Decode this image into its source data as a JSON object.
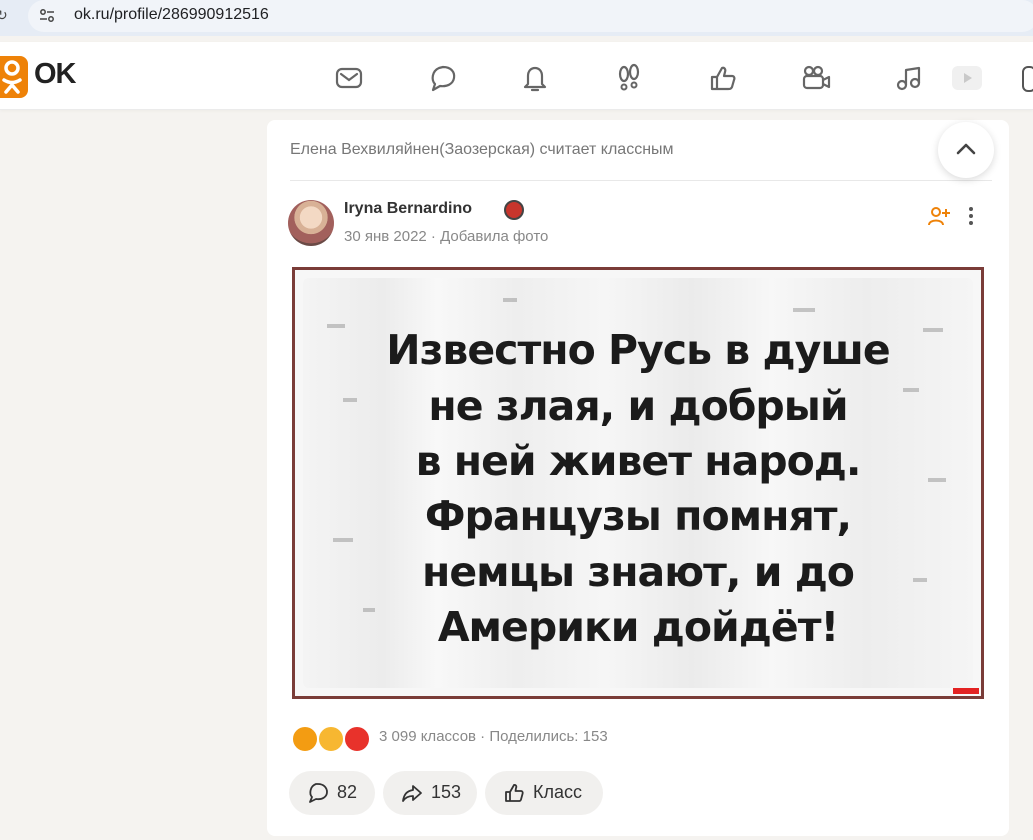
{
  "browser": {
    "url": "ok.ru/profile/286990912516"
  },
  "header": {
    "logo_text": "OK",
    "icons": [
      "mail-icon",
      "chat-bubble-icon",
      "bell-icon",
      "footprints-icon",
      "thumbs-up-icon",
      "video-camera-icon",
      "music-note-icon",
      "play-icon"
    ]
  },
  "feed": {
    "activity_title": "Елена Вехвиляйнен(Заозерская) считает классным",
    "post": {
      "author": "Iryna Bernardino",
      "meta": "30 янв 2022 · Добавила фото",
      "image_text": [
        "Известно Русь в душе",
        "не злая, и добрый",
        "в ней живет народ.",
        "Французы помнят,",
        "немцы знают, и до",
        "Америки дойдёт!"
      ],
      "reactions_text": "3 099 классов  ·  Поделились: 153",
      "actions": {
        "comments": "82",
        "shares": "153",
        "like": "Класс"
      }
    }
  },
  "colors": {
    "brand": "#ee8208",
    "image_frame": "#7a3c38",
    "page_bg": "#f5f3f0"
  }
}
